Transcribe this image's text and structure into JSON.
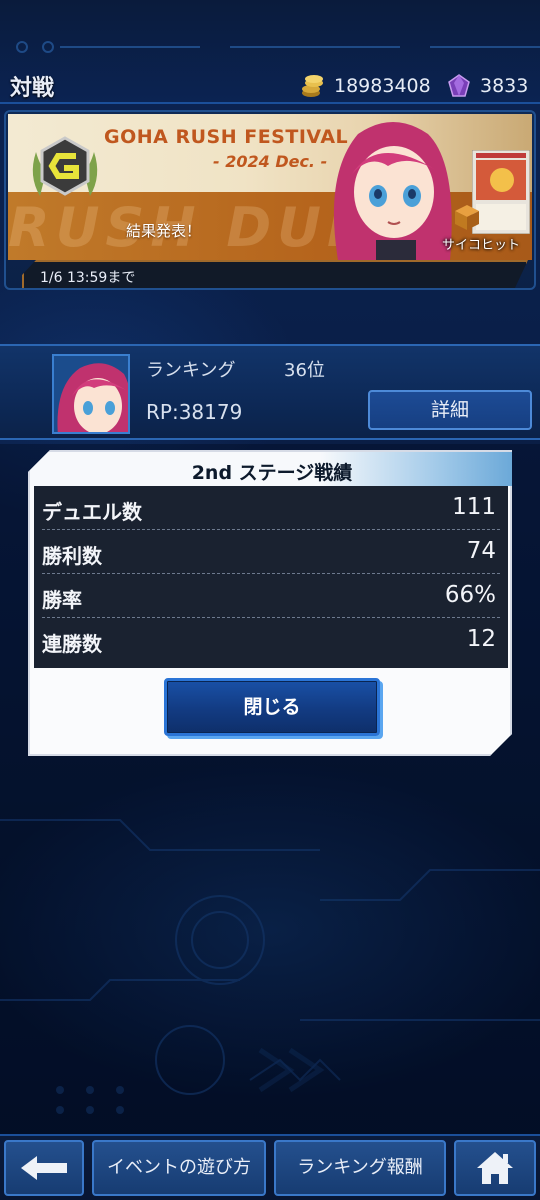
{
  "header": {
    "title": "対戦",
    "gold_amount": "18983408",
    "gem_amount": "3833"
  },
  "banner": {
    "event_title": "GOHA RUSH FESTIVAL",
    "event_subtitle": "- 2024 Dec. -",
    "result_text": "結果発表！",
    "psycho_hit": "サイコヒット",
    "deadline": "1/6 13:59まで"
  },
  "ranking": {
    "label": "ランキング",
    "value": "36位",
    "rp": "RP:38179",
    "detail_button": "詳細"
  },
  "modal": {
    "title": "2nd ステージ戦績",
    "stats": [
      {
        "label": "デュエル数",
        "value": "111"
      },
      {
        "label": "勝利数",
        "value": "74"
      },
      {
        "label": "勝率",
        "value": "66%"
      },
      {
        "label": "連勝数",
        "value": "12"
      }
    ],
    "close_button": "閉じる"
  },
  "bottom_nav": {
    "back_icon": "arrow-left-icon",
    "guide_label": "イベントの遊び方",
    "reward_label": "ランキング報酬",
    "home_icon": "home-icon"
  },
  "colors": {
    "accent_blue": "#1950a6",
    "event_orange": "#c0571e",
    "bg_navy": "#061634"
  }
}
